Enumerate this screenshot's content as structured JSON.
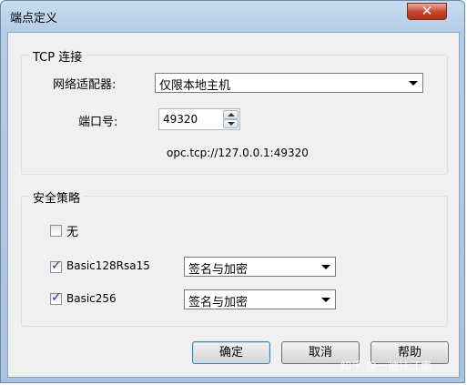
{
  "window": {
    "title": "端点定义",
    "close_glyph": "✕"
  },
  "tcp_group": {
    "label": "TCP 连接",
    "adapter_label": "网络适配器:",
    "adapter_value": "仅限本地主机",
    "port_label": "端口号:",
    "port_value": "49320",
    "url": "opc.tcp://127.0.0.1:49320"
  },
  "security_group": {
    "label": "安全策略",
    "items": [
      {
        "label": "无",
        "checked": false
      },
      {
        "label": "Basic128Rsa15",
        "checked": true,
        "mode": "签名与加密"
      },
      {
        "label": "Basic256",
        "checked": true,
        "mode": "签名与加密"
      }
    ]
  },
  "buttons": {
    "ok": "确定",
    "cancel": "取消",
    "help": "帮助"
  },
  "watermark": "知乎 @一袖抹江南",
  "icons": {
    "checkmark": "✓"
  }
}
